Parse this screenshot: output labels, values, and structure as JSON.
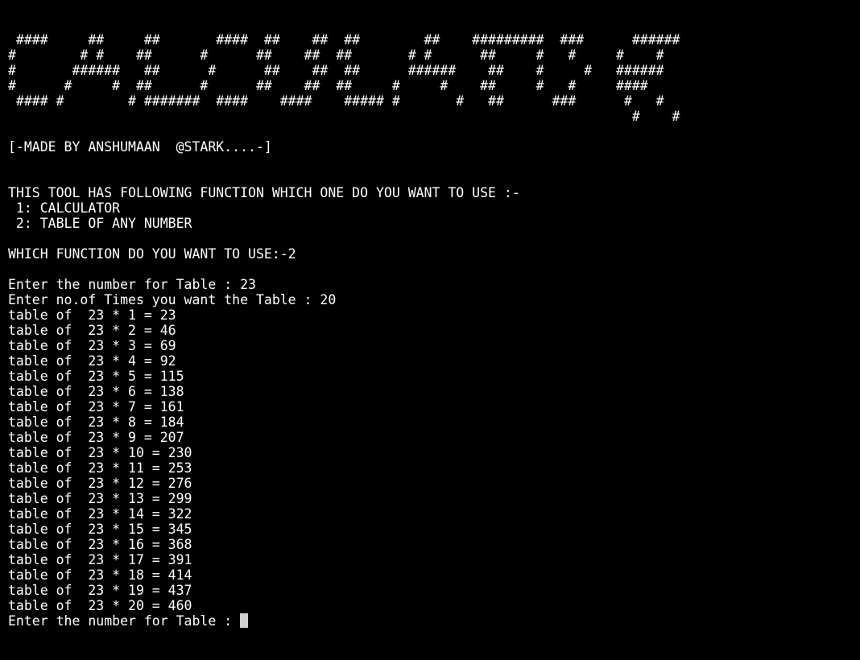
{
  "banner": [
    " ####     ##     ##       ####  ##    ##  ##        ##    #########  ###      ######",
    "#        # #    ##      #      ##    ##  ##       # #      ##     #   #     #    #",
    "#       ######   ##      #      ##    ##  ##      ######    ##    #     #   ######",
    "#      #     #  ##      #      ##    ##  ##     #     #    ##     #   #     ####",
    " #### #        # #######  ####    ####    ##### #       #   ##      ###      #   #",
    "                                                                              #    #"
  ],
  "credit": "[-MADE BY ANSHUMAAN  @STARK....-]",
  "menu": {
    "intro": "THIS TOOL HAS FOLLOWING FUNCTION WHICH ONE DO YOU WANT TO USE :-",
    "options": [
      " 1: CALCULATOR",
      " 2: TABLE OF ANY NUMBER"
    ]
  },
  "choice_prompt": "WHICH FUNCTION DO YOU WANT TO USE:-2",
  "table_number_prompt": "Enter the number for Table : 23",
  "times_prompt": "Enter no.of Times you want the Table : 20",
  "table_rows": [
    "table of  23 * 1 = 23",
    "table of  23 * 2 = 46",
    "table of  23 * 3 = 69",
    "table of  23 * 4 = 92",
    "table of  23 * 5 = 115",
    "table of  23 * 6 = 138",
    "table of  23 * 7 = 161",
    "table of  23 * 8 = 184",
    "table of  23 * 9 = 207",
    "table of  23 * 10 = 230",
    "table of  23 * 11 = 253",
    "table of  23 * 12 = 276",
    "table of  23 * 13 = 299",
    "table of  23 * 14 = 322",
    "table of  23 * 15 = 345",
    "table of  23 * 16 = 368",
    "table of  23 * 17 = 391",
    "table of  23 * 18 = 414",
    "table of  23 * 19 = 437",
    "table of  23 * 20 = 460"
  ],
  "current_prompt": "Enter the number for Table : ",
  "colors": {
    "background": "#000000",
    "text": "#ffffff",
    "cursor": "#cfcfcf"
  }
}
